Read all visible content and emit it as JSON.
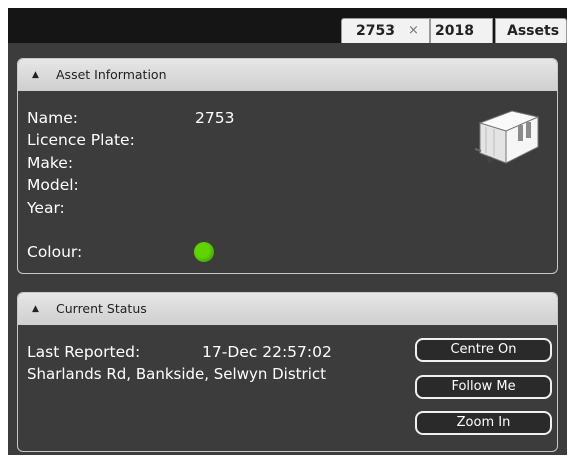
{
  "tabs": [
    {
      "label": "2753",
      "close": "×"
    },
    {
      "label": "2018"
    },
    {
      "label": "Assets"
    }
  ],
  "asset_info": {
    "header": "Asset Information",
    "labels": {
      "name": "Name:",
      "licence_plate": "Licence Plate:",
      "make": "Make:",
      "model": "Model:",
      "year": "Year:",
      "colour": "Colour:"
    },
    "values": {
      "name": "2753",
      "licence_plate": "",
      "make": "",
      "model": "",
      "year": ""
    },
    "colour_swatch": "#5fd400",
    "icon": "portable-cabin-trailer-icon"
  },
  "current_status": {
    "header": "Current Status",
    "last_reported_label": "Last Reported:",
    "last_reported_value": "17-Dec 22:57:02",
    "location": "Sharlands Rd, Bankside, Selwyn District",
    "buttons": {
      "centre_on": "Centre On",
      "follow_me": "Follow Me",
      "zoom_in": "Zoom In"
    }
  },
  "colors": {
    "panel_bg": "#3c3c3c",
    "tabbar_bg": "#151515",
    "header_bg": "#dcdcdc",
    "text": "#ffffff"
  }
}
